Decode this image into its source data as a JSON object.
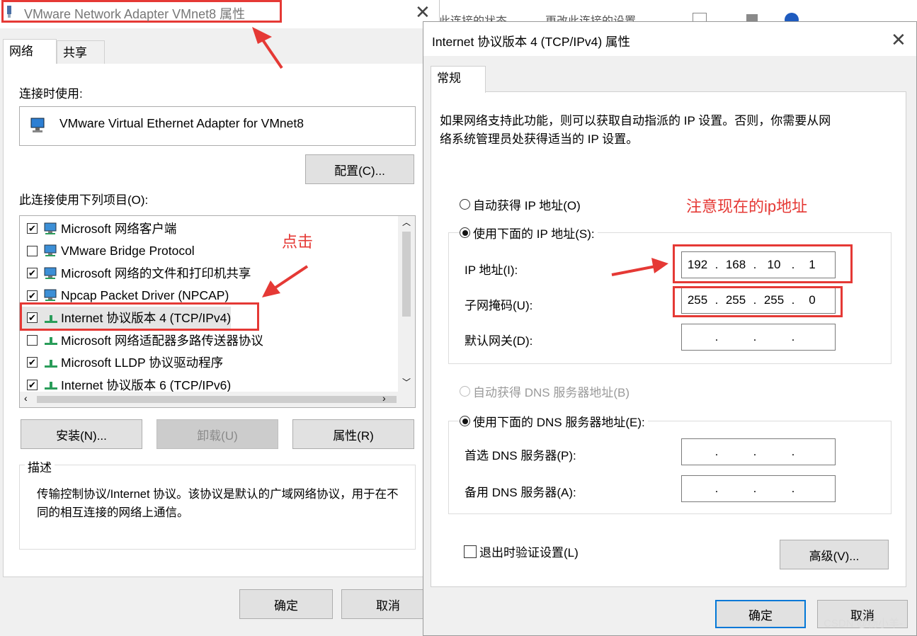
{
  "background_window": {
    "text_left": "此连接的状态",
    "text_right": "更改此连接的设置"
  },
  "left_dialog": {
    "title": "VMware Network Adapter VMnet8 属性",
    "tabs": [
      "网络",
      "共享"
    ],
    "connect_using_label": "连接时使用:",
    "adapter_name": "VMware Virtual Ethernet Adapter for VMnet8",
    "configure_button": "配置(C)...",
    "items_label": "此连接使用下列项目(O):",
    "items": [
      {
        "label": "Microsoft 网络客户端",
        "checked": true
      },
      {
        "label": "VMware Bridge Protocol",
        "checked": false
      },
      {
        "label": "Microsoft 网络的文件和打印机共享",
        "checked": true
      },
      {
        "label": "Npcap Packet Driver (NPCAP)",
        "checked": true
      },
      {
        "label": "Internet 协议版本 4 (TCP/IPv4)",
        "checked": true
      },
      {
        "label": "Microsoft 网络适配器多路传送器协议",
        "checked": false
      },
      {
        "label": "Microsoft LLDP 协议驱动程序",
        "checked": true
      },
      {
        "label": "Internet 协议版本 6 (TCP/IPv6)",
        "checked": true
      }
    ],
    "install_button": "安装(N)...",
    "uninstall_button": "卸载(U)",
    "properties_button": "属性(R)",
    "description_title": "描述",
    "description_text": "传输控制协议/Internet 协议。该协议是默认的广域网络协议，用于在不同的相互连接的网络上通信。",
    "ok_button": "确定",
    "cancel_button": "取消",
    "annotation_click": "点击"
  },
  "right_dialog": {
    "title": "Internet 协议版本 4 (TCP/IPv4) 属性",
    "tab": "常规",
    "intro_text_line1": "如果网络支持此功能，则可以获取自动指派的 IP 设置。否则，你需要从网",
    "intro_text_line2": "络系统管理员处获得适当的 IP 设置。",
    "auto_ip_label": "自动获得 IP 地址(O)",
    "manual_ip_label": "使用下面的 IP 地址(S):",
    "ip_label": "IP 地址(I):",
    "ip_value": [
      "192",
      "168",
      "10",
      "1"
    ],
    "subnet_label": "子网掩码(U):",
    "subnet_value": [
      "255",
      "255",
      "255",
      "0"
    ],
    "gateway_label": "默认网关(D):",
    "gateway_value": [
      "",
      "",
      "",
      ""
    ],
    "auto_dns_label": "自动获得 DNS 服务器地址(B)",
    "manual_dns_label": "使用下面的 DNS 服务器地址(E):",
    "preferred_dns_label": "首选 DNS 服务器(P):",
    "alternate_dns_label": "备用 DNS 服务器(A):",
    "validate_label": "退出时验证设置(L)",
    "advanced_button": "高级(V)...",
    "ok_button": "确定",
    "cancel_button": "取消",
    "annotation_ip": "注意现在的ip地址"
  },
  "watermark": "CSDN @杨小羊-",
  "colors": {
    "annotation_red": "#e53935",
    "dialog_bg": "#f0f0f0",
    "focus_blue": "#0078d7"
  }
}
